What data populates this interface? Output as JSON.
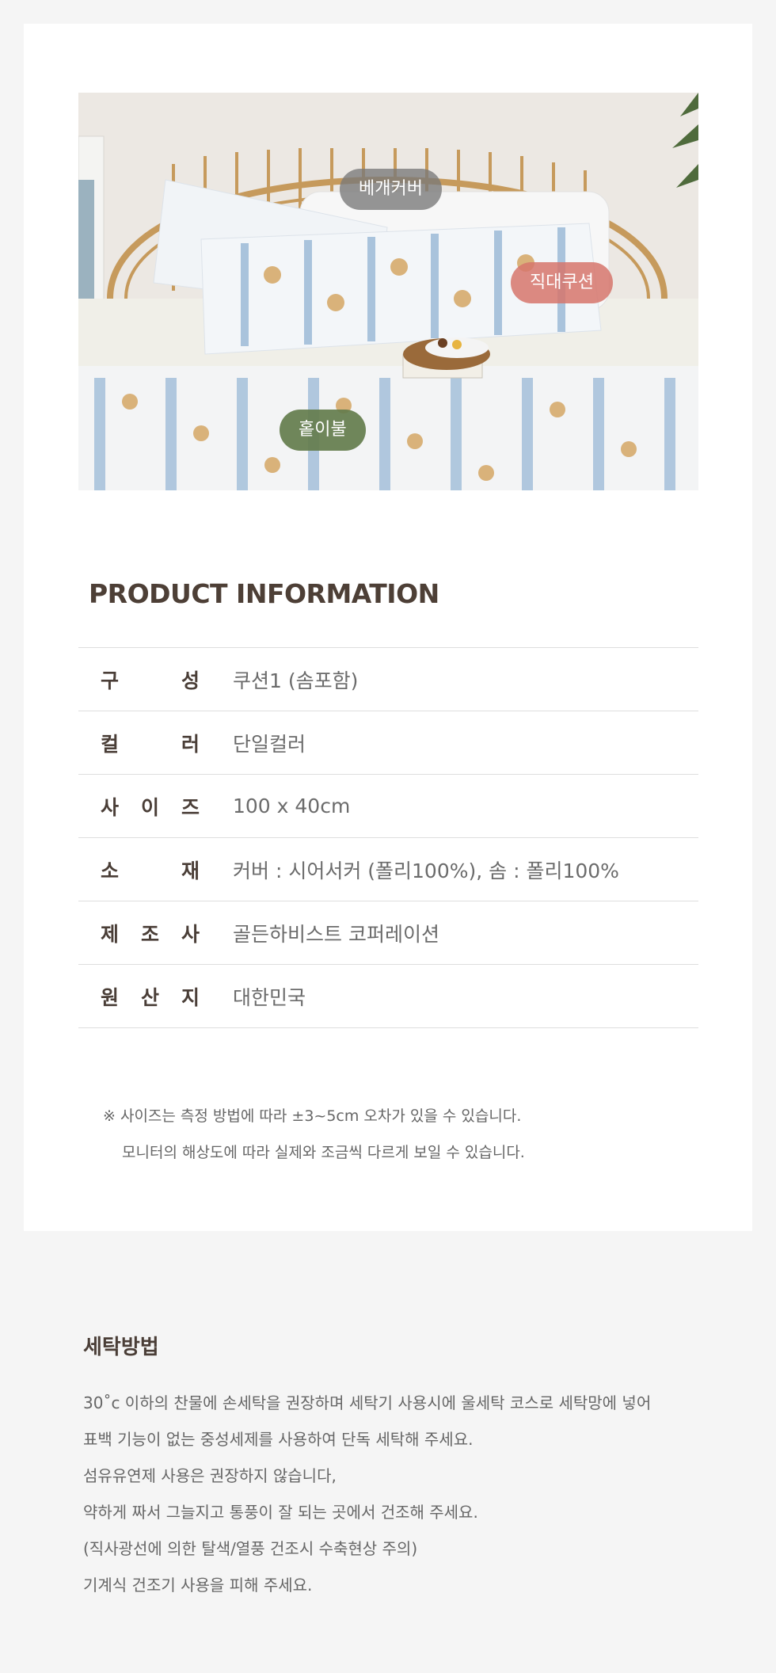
{
  "photo": {
    "tags": {
      "pillow_cover": "베개커버",
      "long_cushion": "직대쿠션",
      "quilt": "홑이불"
    }
  },
  "product_info": {
    "title": "PRODUCT INFORMATION",
    "rows": [
      {
        "label": [
          "구",
          "성"
        ],
        "value": "쿠션1 (솜포함)"
      },
      {
        "label": [
          "컬",
          "러"
        ],
        "value": "단일컬러"
      },
      {
        "label": [
          "사",
          "이",
          "즈"
        ],
        "value": "100 x 40cm"
      },
      {
        "label": [
          "소",
          "재"
        ],
        "value": "커버 : 시어서커 (폴리100%), 솜 : 폴리100%"
      },
      {
        "label": [
          "제",
          "조",
          "사"
        ],
        "value": "골든하비스트 코퍼레이션"
      },
      {
        "label": [
          "원",
          "산",
          "지"
        ],
        "value": "대한민국"
      }
    ]
  },
  "notes": {
    "line1": "※ 사이즈는 측정 방법에 따라 ±3~5cm 오차가 있을 수 있습니다.",
    "line2": "모니터의 해상도에 따라 실제와 조금씩 다르게 보일 수 있습니다."
  },
  "washing": {
    "title": "세탁방법",
    "lines": [
      "30˚c 이하의 찬물에 손세탁을 권장하며 세탁기 사용시에 울세탁 코스로 세탁망에 넣어",
      "표백 기능이 없는 중성세제를 사용하여 단독 세탁해 주세요.",
      "섬유유연제 사용은 권장하지 않습니다,",
      "약하게 짜서 그늘지고 통풍이 잘 되는 곳에서 건조해 주세요.",
      "(직사광선에 의한 탈색/열풍 건조시 수축현상 주의)",
      "기계식 건조기 사용을 피해 주세요."
    ]
  }
}
